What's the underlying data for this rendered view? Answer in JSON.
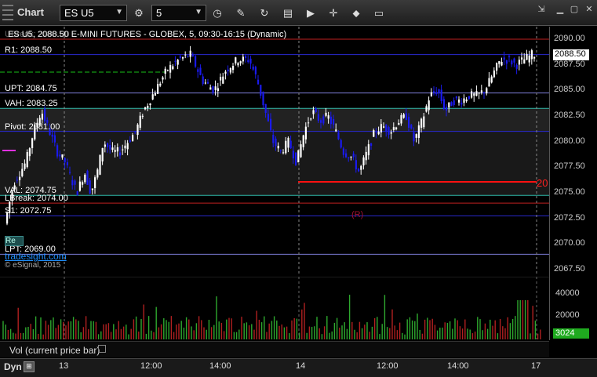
{
  "window": {
    "title": "Chart"
  },
  "toolbar": {
    "symbol": "ES U5",
    "interval": "5"
  },
  "header": {
    "text": "ES U5, 2088.50 E-MINI FUTURES - GLOBEX, 5, 09:30-16:15 (Dynamic)",
    "overlap": "UBreak: 2090.00"
  },
  "levels": [
    {
      "label": "R1: 2088.50",
      "value": 2088.5,
      "color": "#2a2ad0"
    },
    {
      "label": "UPT: 2084.75",
      "value": 2084.75,
      "color": "#7d7dd8"
    },
    {
      "label": "VAH: 2083.25",
      "value": 2083.25,
      "color": "#2fb8a8"
    },
    {
      "label": "Pivot: 2081.00",
      "value": 2081.0,
      "color": "#2a2ad0"
    },
    {
      "label": "VAL: 2074.75",
      "value": 2074.75,
      "color": "#2fb8a8"
    },
    {
      "label": "LBreak: 2074.00",
      "value": 2074.0,
      "color": "#c02020"
    },
    {
      "label": "S1: 2072.75",
      "value": 2072.75,
      "color": "#2a2ad0"
    },
    {
      "label": "LPT: 2069.00",
      "value": 2069.0,
      "color": "#7d7dd8"
    }
  ],
  "ubreak_value": 2090.0,
  "watermark": "tradesight.com",
  "copyright": "© eSignal, 2015",
  "last_price": "2088.50",
  "price_ticks": [
    "2090.00",
    "2087.50",
    "2085.00",
    "2082.50",
    "2080.00",
    "2077.50",
    "2075.00",
    "2072.50",
    "2070.00",
    "2067.50"
  ],
  "label_20": "20",
  "r_marker": "(R)",
  "volume": {
    "title": "Vol (current price bar)",
    "ticks": [
      "40000",
      "20000"
    ],
    "current": "3024"
  },
  "x_labels": [
    "13",
    "12:00",
    "14:00",
    "14",
    "12:00",
    "14:00",
    "17"
  ],
  "bottom": {
    "dyn": "Dyn"
  },
  "colors": {
    "up": "#ffffff",
    "down": "#1a1aee",
    "vol_up": "#2ea82e",
    "vol_down": "#b02020"
  }
}
